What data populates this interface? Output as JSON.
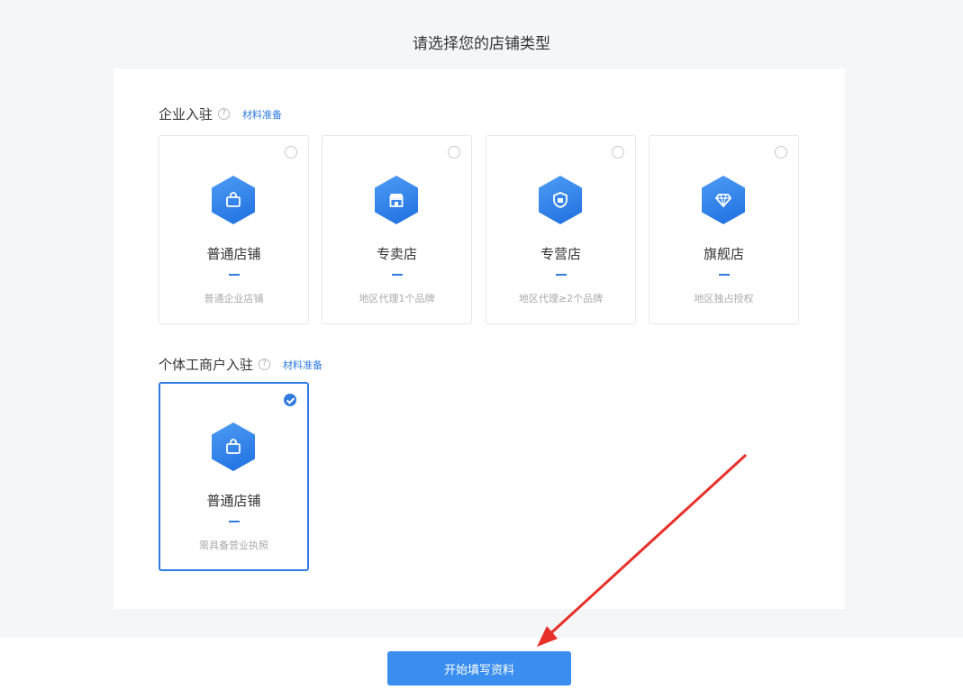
{
  "page": {
    "title": "请选择您的店铺类型"
  },
  "enterprise": {
    "title": "企业入驻",
    "help": "?",
    "materials_link": "材料准备",
    "cards": [
      {
        "name": "普通店铺",
        "desc": "普通企业店铺",
        "icon": "shopping-bag-icon",
        "selected": false
      },
      {
        "name": "专卖店",
        "desc": "地区代理1个品牌",
        "icon": "storefront-icon",
        "selected": false
      },
      {
        "name": "专营店",
        "desc": "地区代理≥2个品牌",
        "icon": "shield-shop-icon",
        "selected": false
      },
      {
        "name": "旗舰店",
        "desc": "地区独占授权",
        "icon": "diamond-icon",
        "selected": false
      }
    ]
  },
  "individual": {
    "title": "个体工商户入驻",
    "help": "?",
    "materials_link": "材料准备",
    "cards": [
      {
        "name": "普通店铺",
        "desc": "需具备营业执照",
        "icon": "shopping-bag-icon",
        "selected": true
      }
    ]
  },
  "footer": {
    "start_button": "开始填写资料"
  },
  "colors": {
    "accent": "#2f7be0",
    "button": "#3a8ef0",
    "arrow": "#e8302a"
  }
}
